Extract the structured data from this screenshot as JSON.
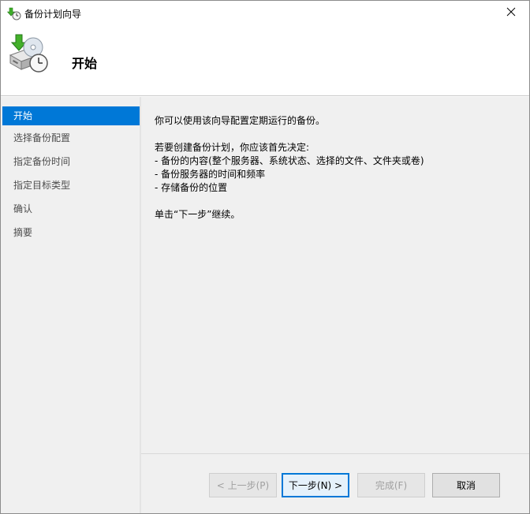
{
  "window": {
    "title": "备份计划向导"
  },
  "header": {
    "title": "开始"
  },
  "nav": {
    "items": [
      {
        "label": "开始"
      },
      {
        "label": "选择备份配置"
      },
      {
        "label": "指定备份时间"
      },
      {
        "label": "指定目标类型"
      },
      {
        "label": "确认"
      },
      {
        "label": "摘要"
      }
    ]
  },
  "content": {
    "intro": "你可以使用该向导配置定期运行的备份。",
    "decide_heading": "若要创建备份计划，你应该首先决定:",
    "bullets": [
      "- 备份的内容(整个服务器、系统状态、选择的文件、文件夹或卷)",
      "- 备份服务器的时间和频率",
      "- 存储备份的位置"
    ],
    "continue_text": "单击“下一步”继续。"
  },
  "buttons": {
    "prev": "< 上一步(P)",
    "next": "下一步(N) >",
    "finish": "完成(F)",
    "cancel": "取消"
  }
}
